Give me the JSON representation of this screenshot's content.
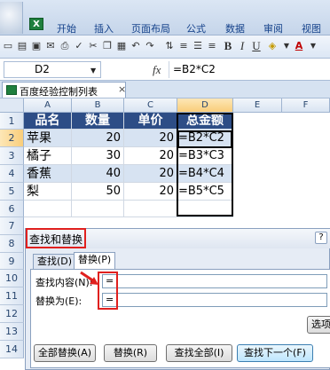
{
  "ribbon": {
    "tabs": [
      "开始",
      "插入",
      "页面布局",
      "公式",
      "数据",
      "审阅",
      "视图"
    ]
  },
  "toolbar": {
    "bold": "B",
    "italic": "I",
    "underline": "U",
    "font_color_letter": "A"
  },
  "formula_bar": {
    "name_box": "D2",
    "fx": "fx",
    "formula": "=B2*C2"
  },
  "workbook_tab": {
    "title": "百度经验控制列表",
    "close": "×"
  },
  "sheet": {
    "columns": [
      "A",
      "B",
      "C",
      "D",
      "E",
      "F"
    ],
    "row_numbers": [
      "1",
      "2",
      "3",
      "4",
      "5",
      "6",
      "7",
      "8",
      "9",
      "10",
      "11",
      "12",
      "13",
      "14"
    ],
    "header": [
      "品名",
      "数量",
      "单价",
      "总金额"
    ],
    "rows": [
      [
        "苹果",
        "20",
        "20",
        "=B2*C2"
      ],
      [
        "橘子",
        "30",
        "20",
        "=B3*C3"
      ],
      [
        "香蕉",
        "40",
        "20",
        "=B4*C4"
      ],
      [
        "梨",
        "50",
        "20",
        "=B5*C5"
      ]
    ],
    "selected_cell": "D2"
  },
  "dialog": {
    "title": "查找和替换",
    "help": "?",
    "tabs": [
      "查找(D)",
      "替换(P)"
    ],
    "active_tab": "替换(P)",
    "find_label": "查找内容(N):",
    "find_value": "=",
    "replace_label": "替换为(E):",
    "replace_value": "=",
    "buttons": {
      "options": "选项",
      "replace_all": "全部替换(A)",
      "replace": "替换(R)",
      "find_all": "查找全部(I)",
      "find_next": "查找下一个(F)"
    }
  },
  "colors": {
    "header_fill": "#2d4d86",
    "light_row_fill": "#d7e3f2",
    "annotation_red": "#e0201e"
  }
}
